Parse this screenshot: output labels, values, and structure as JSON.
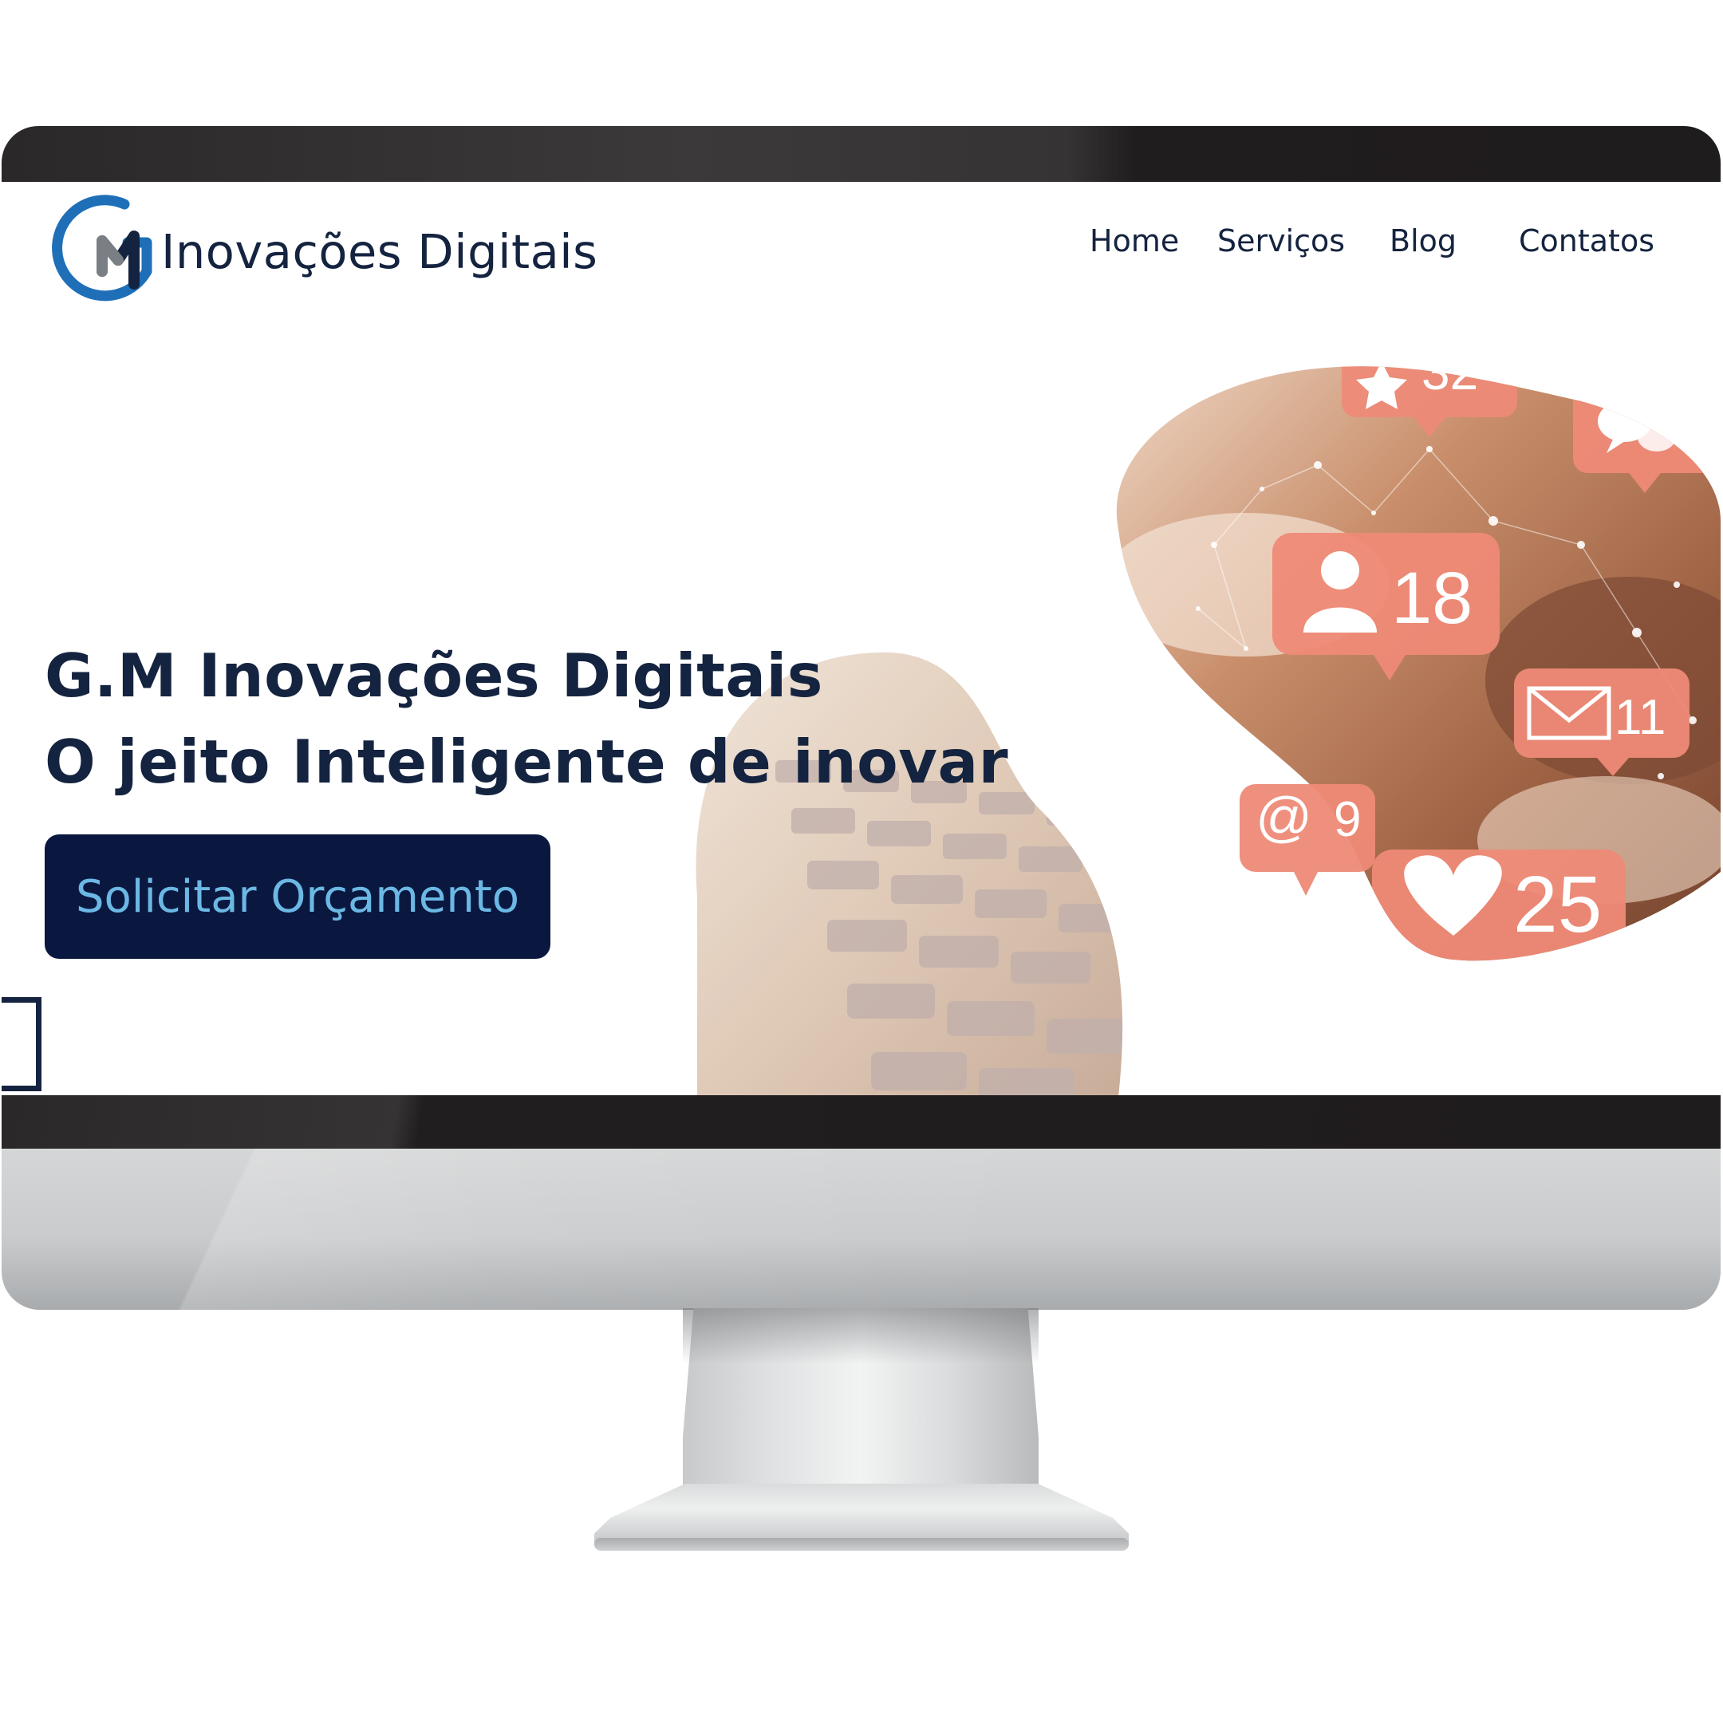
{
  "brand": {
    "name": "Inovações Digitais",
    "logo_icon": "gm-logo-icon",
    "primary_color": "#14233f",
    "accent_color": "#1f6fb8"
  },
  "nav": {
    "items": [
      {
        "label": "Home"
      },
      {
        "label": "Serviços"
      },
      {
        "label": "Blog"
      },
      {
        "label": "Contatos"
      }
    ]
  },
  "hero": {
    "title_line1": "G.M Inovações Digitais",
    "title_line2": "O jeito Inteligente de inovar",
    "cta_label": "Solicitar Orçamento",
    "cta_bg": "#0a1840",
    "cta_text_color": "#6cb8e4"
  },
  "notifications": {
    "stars": "32",
    "followers": "18",
    "messages": "11",
    "mentions": "9",
    "likes": "25",
    "icons": [
      "star-icon",
      "speech-bubble-icon",
      "user-icon",
      "envelope-icon",
      "at-sign-icon",
      "heart-icon"
    ]
  }
}
